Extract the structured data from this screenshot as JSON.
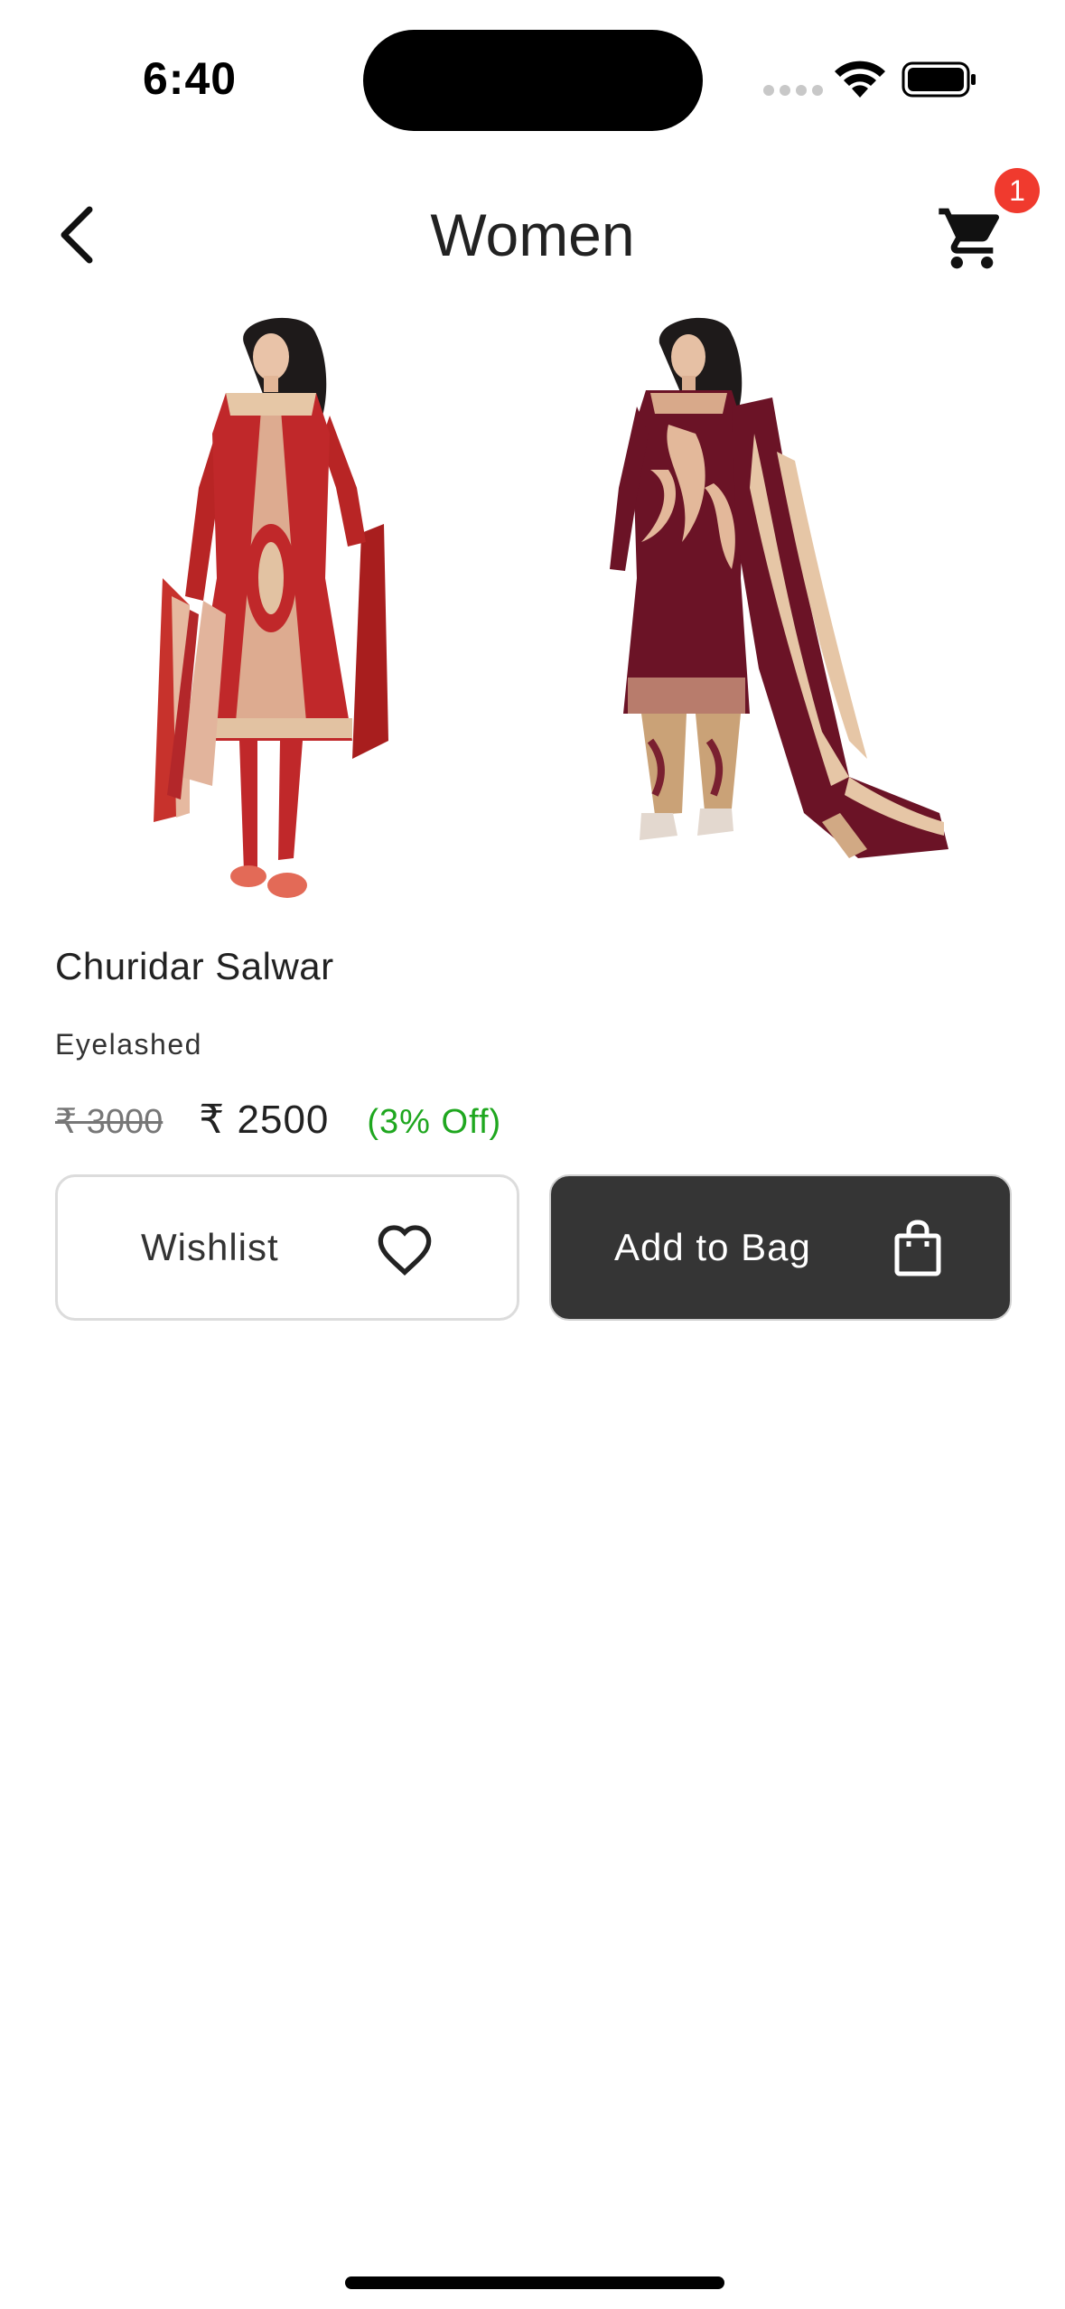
{
  "status_bar": {
    "time": "6:40"
  },
  "nav": {
    "title": "Women",
    "cart_count": "1"
  },
  "product": {
    "name": "Churidar Salwar",
    "brand": "Eyelashed",
    "mrp": "₹ 3000",
    "price": "₹ 2500",
    "discount": "(3% Off)"
  },
  "actions": {
    "wishlist_label": "Wishlist",
    "add_to_bag_label": "Add to Bag"
  },
  "colors": {
    "badge": "#f03a2e",
    "discount": "#1fa71f",
    "bag_button": "#353535"
  },
  "icons": {
    "back": "chevron-left-icon",
    "cart": "cart-icon",
    "wishlist": "heart-icon",
    "bag": "shopping-bag-icon"
  }
}
